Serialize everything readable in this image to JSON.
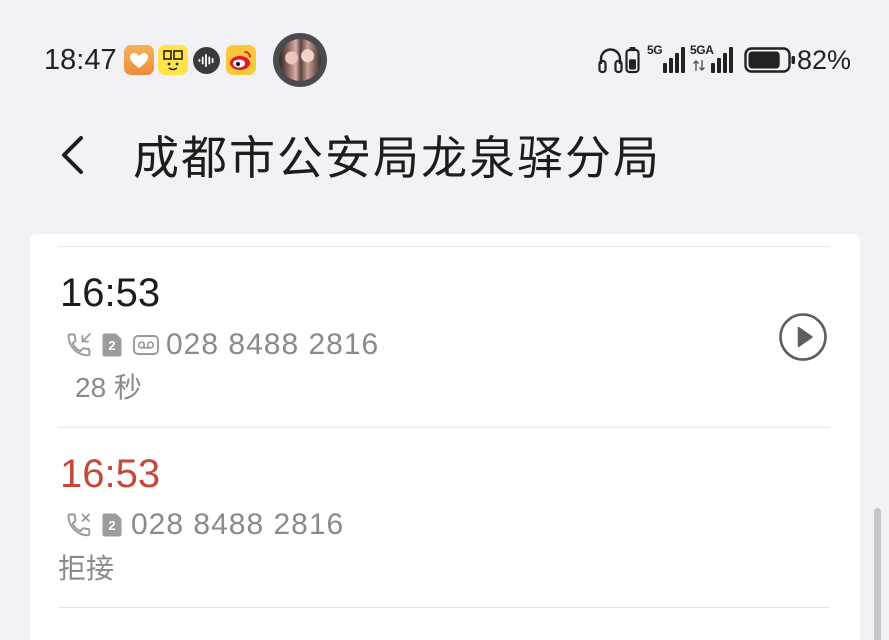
{
  "status_bar": {
    "time": "18:47",
    "notification_icons": [
      "heart-app-icon",
      "xianyu-app-icon",
      "voice-app-icon",
      "weibo-app-icon"
    ],
    "avatar_icon": "avatar-icon",
    "headphones_icon": "headphones-icon",
    "headphone_battery_level": 0.6,
    "signal_1_label": "5G",
    "signal_2_label": "5GA",
    "signal_bars": 4,
    "battery_level": 0.82,
    "battery_text": "82%"
  },
  "header": {
    "back_icon": "chevron-left-icon",
    "title": "成都市公安局龙泉驿分局"
  },
  "calls": [
    {
      "icon": "incoming-call-icon",
      "time": "16:53",
      "sim": "2",
      "has_voicemail": true,
      "number": "028 8488 2816",
      "detail": "28 秒",
      "action_icon": "play-icon"
    },
    {
      "icon": "rejected-call-icon",
      "time": "16:53",
      "sim": "2",
      "has_voicemail": false,
      "number": "028 8488 2816",
      "detail": "拒接"
    }
  ],
  "colors": {
    "background": "#f1f2f6",
    "card": "#ffffff",
    "primary_text": "#1c1c1c",
    "secondary_text": "#8a8a8a",
    "missed_call": "#c8473b"
  }
}
